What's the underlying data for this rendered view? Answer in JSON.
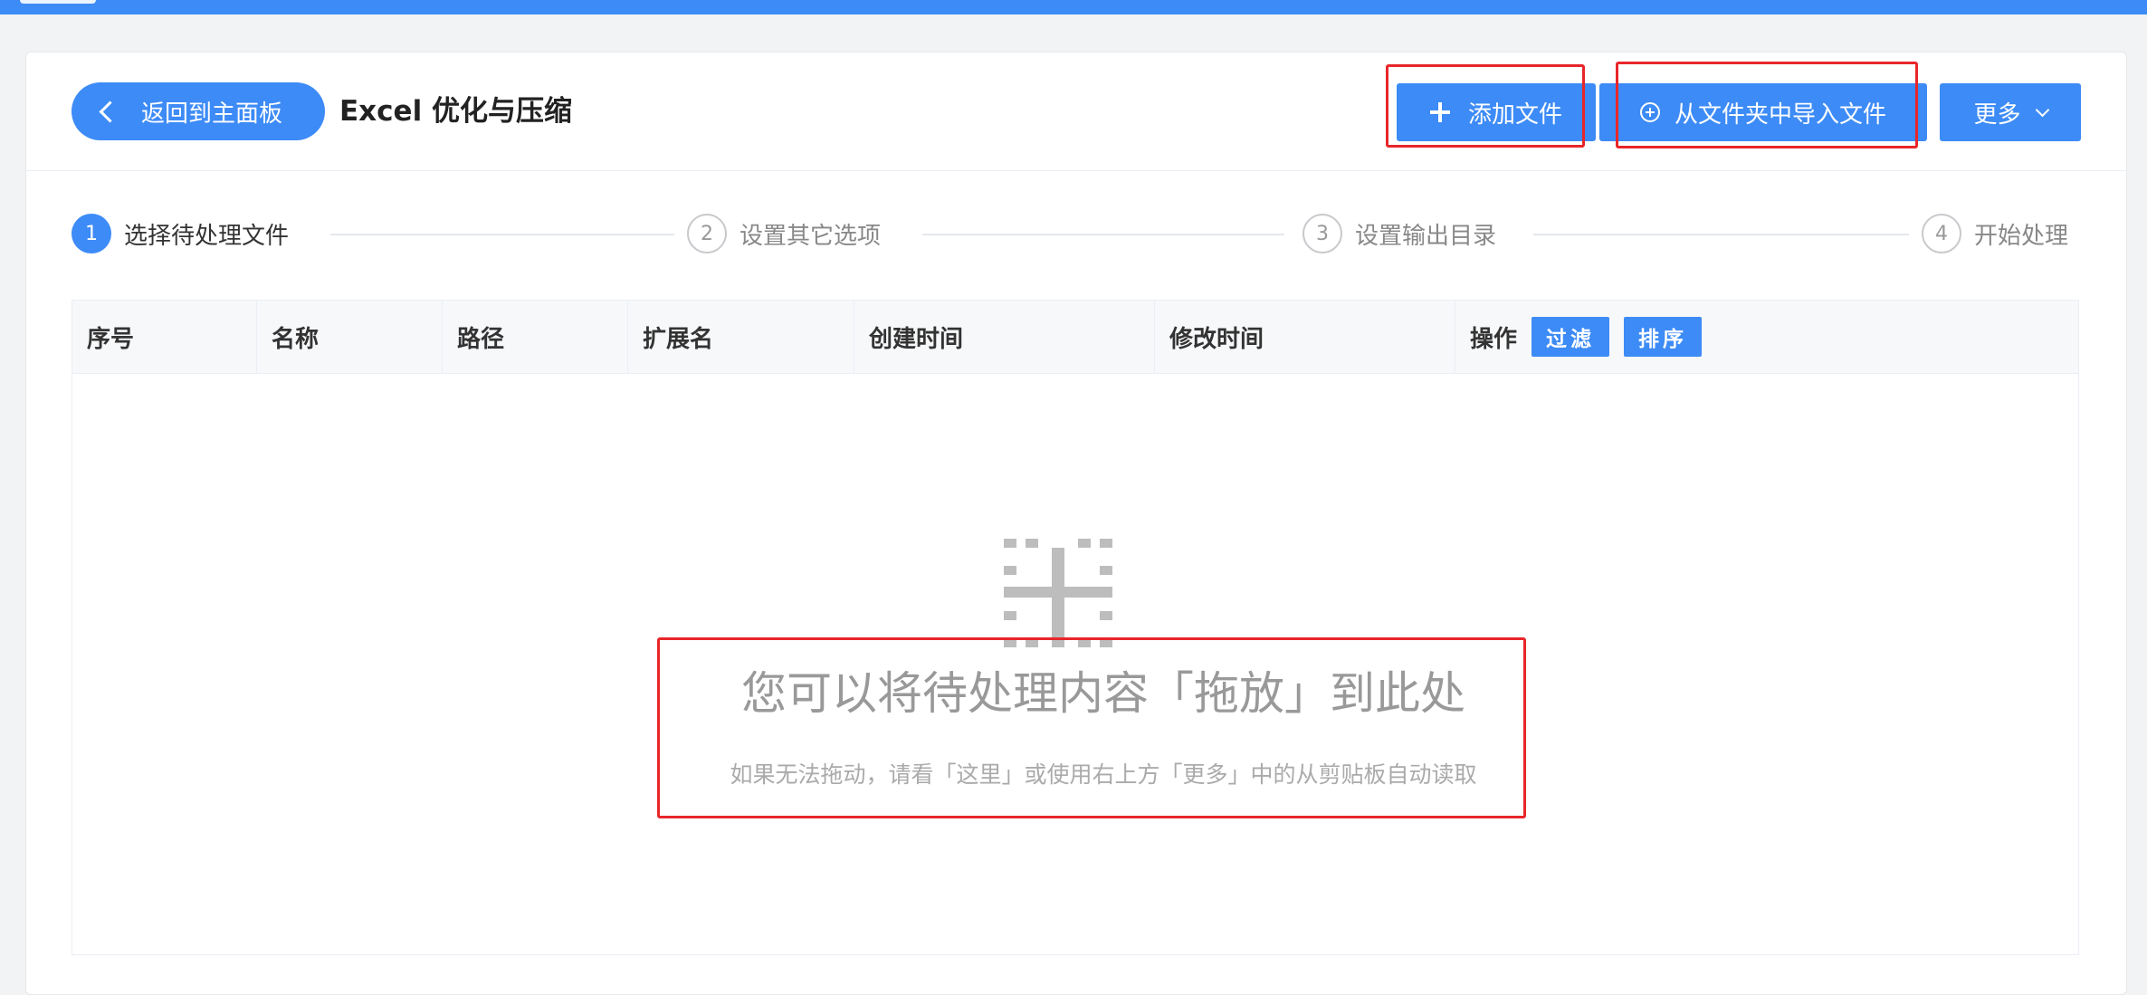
{
  "header": {
    "back_label": "返回到主面板",
    "title": "Excel 优化与压缩",
    "add_file_label": "添加文件",
    "import_folder_label": "从文件夹中导入文件",
    "more_label": "更多"
  },
  "steps": [
    {
      "num": "1",
      "label": "选择待处理文件",
      "active": true
    },
    {
      "num": "2",
      "label": "设置其它选项",
      "active": false
    },
    {
      "num": "3",
      "label": "设置输出目录",
      "active": false
    },
    {
      "num": "4",
      "label": "开始处理",
      "active": false
    }
  ],
  "table": {
    "columns": [
      "序号",
      "名称",
      "路径",
      "扩展名",
      "创建时间",
      "修改时间",
      "操作"
    ],
    "filter_label": "过滤",
    "sort_label": "排序"
  },
  "empty_state": {
    "title": "您可以将待处理内容「拖放」到此处",
    "hint": "如果无法拖动，请看「这里」或使用右上方「更多」中的从剪贴板自动读取"
  },
  "colors": {
    "accent": "#3d8bf6",
    "highlight": "#e8262a"
  }
}
